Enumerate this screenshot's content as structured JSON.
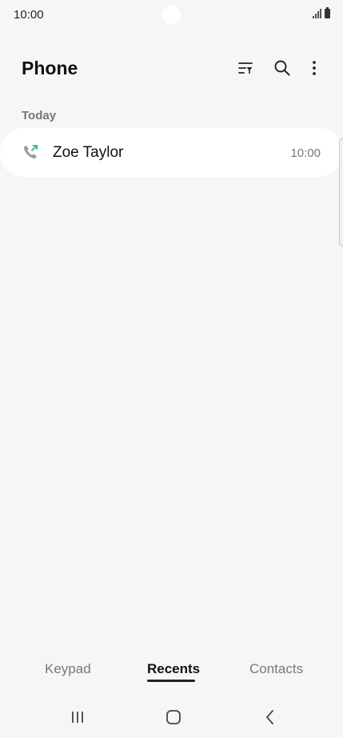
{
  "status_bar": {
    "time": "10:00"
  },
  "header": {
    "title": "Phone"
  },
  "icons": {
    "filter": "filter-icon",
    "search": "search-icon",
    "more": "more-vertical-icon",
    "call": "outgoing-call-icon"
  },
  "recents": {
    "section_label": "Today",
    "calls": [
      {
        "name": "Zoe Taylor",
        "time": "10:00"
      }
    ]
  },
  "tabs": {
    "items": [
      {
        "label": "Keypad"
      },
      {
        "label": "Recents"
      },
      {
        "label": "Contacts"
      }
    ],
    "selected": "Recents"
  },
  "colors": {
    "background": "#f6f6f6",
    "card": "#ffffff",
    "call_arrow": "#2fb87e",
    "secondary_text": "#777777"
  }
}
